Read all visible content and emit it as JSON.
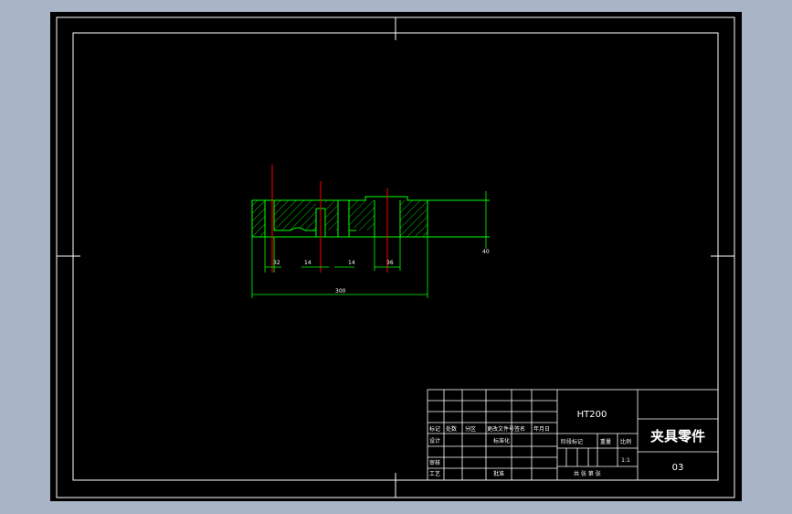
{
  "app": {
    "background_color": "#a9b4c6",
    "drawing_background": "#000000"
  },
  "colors": {
    "border": "#ffffff",
    "part_outline": "#00ff00",
    "hatch": "#00ff00",
    "center_line": "#ff0000",
    "dimension": "#00ff00",
    "dim_text": "#ffffff",
    "title_block": "#ffffff"
  },
  "drawing": {
    "dimensions": {
      "overall_width": "300",
      "height": "40",
      "left_pocket": "32",
      "mid_slot_a": "14",
      "mid_slot_b": "14",
      "right_pocket": "36"
    }
  },
  "title_block": {
    "material": "HT200",
    "part_name": "夹具零件",
    "drawing_number": "03",
    "scale_value": "1:1",
    "row_labels_left": {
      "mark": "标记",
      "count": "处数",
      "zone": "分区",
      "change_doc": "更改文件号",
      "signature": "签名",
      "date": "年月日",
      "designer": "设计",
      "standardize": "标准化",
      "reviewer": "审核",
      "process": "工艺",
      "approve": "批准"
    },
    "row_labels_right": {
      "stage_mark": "阶段标记",
      "weight": "重量",
      "scale": "比例",
      "sheets_info": "共  张  第  张"
    }
  }
}
